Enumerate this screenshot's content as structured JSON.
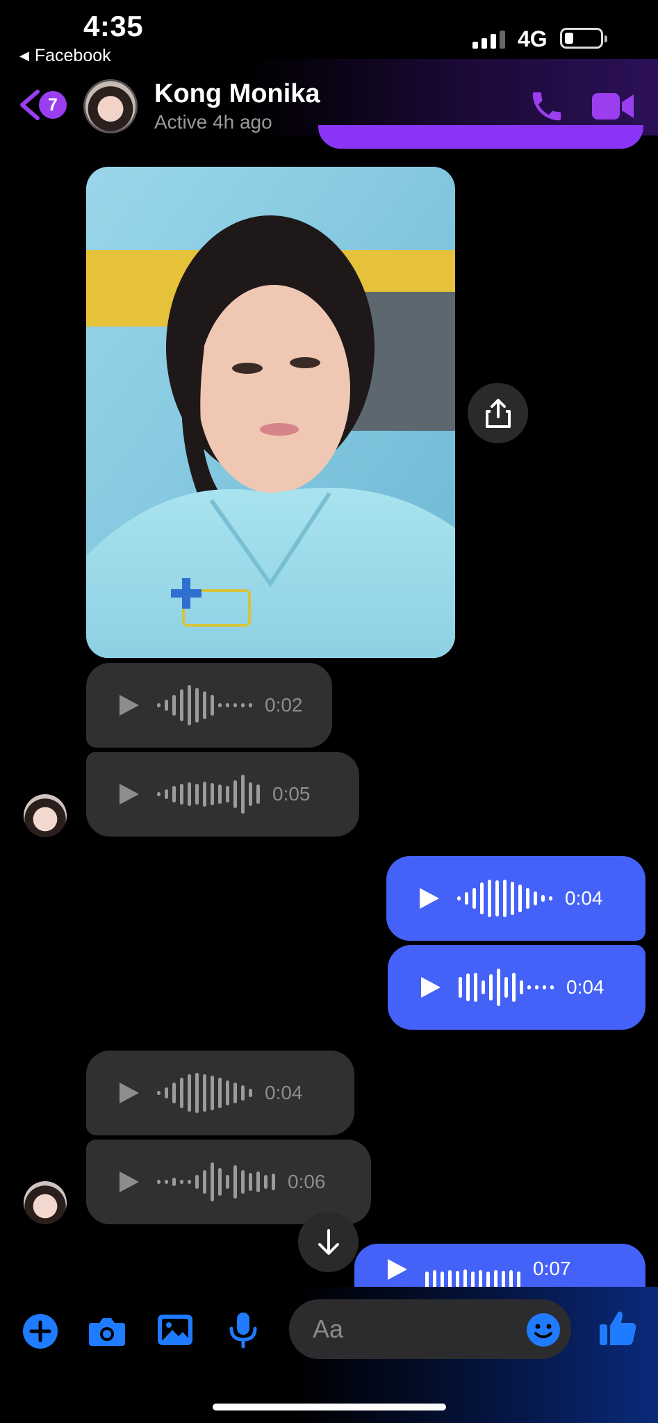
{
  "status_bar": {
    "time": "4:35",
    "back_app": "Facebook",
    "network": "4G"
  },
  "header": {
    "unread_count": "7",
    "contact_name": "Kong Monika",
    "contact_status": "Active 4h ago",
    "accent_color": "#9a3ef0"
  },
  "conversation": {
    "voice_messages": [
      {
        "direction": "incoming",
        "duration": "0:02"
      },
      {
        "direction": "incoming",
        "duration": "0:05"
      },
      {
        "direction": "outgoing",
        "duration": "0:04"
      },
      {
        "direction": "outgoing",
        "duration": "0:04"
      },
      {
        "direction": "incoming",
        "duration": "0:04"
      },
      {
        "direction": "incoming",
        "duration": "0:06"
      },
      {
        "direction": "outgoing",
        "duration": "0:07"
      }
    ],
    "incoming_bubble_color": "#303030",
    "outgoing_bubble_color": "#4462f7"
  },
  "composer": {
    "placeholder": "Aa",
    "tools": [
      "plus-icon",
      "camera-icon",
      "gallery-icon",
      "microphone-icon"
    ],
    "tool_color": "#1f7bff"
  }
}
